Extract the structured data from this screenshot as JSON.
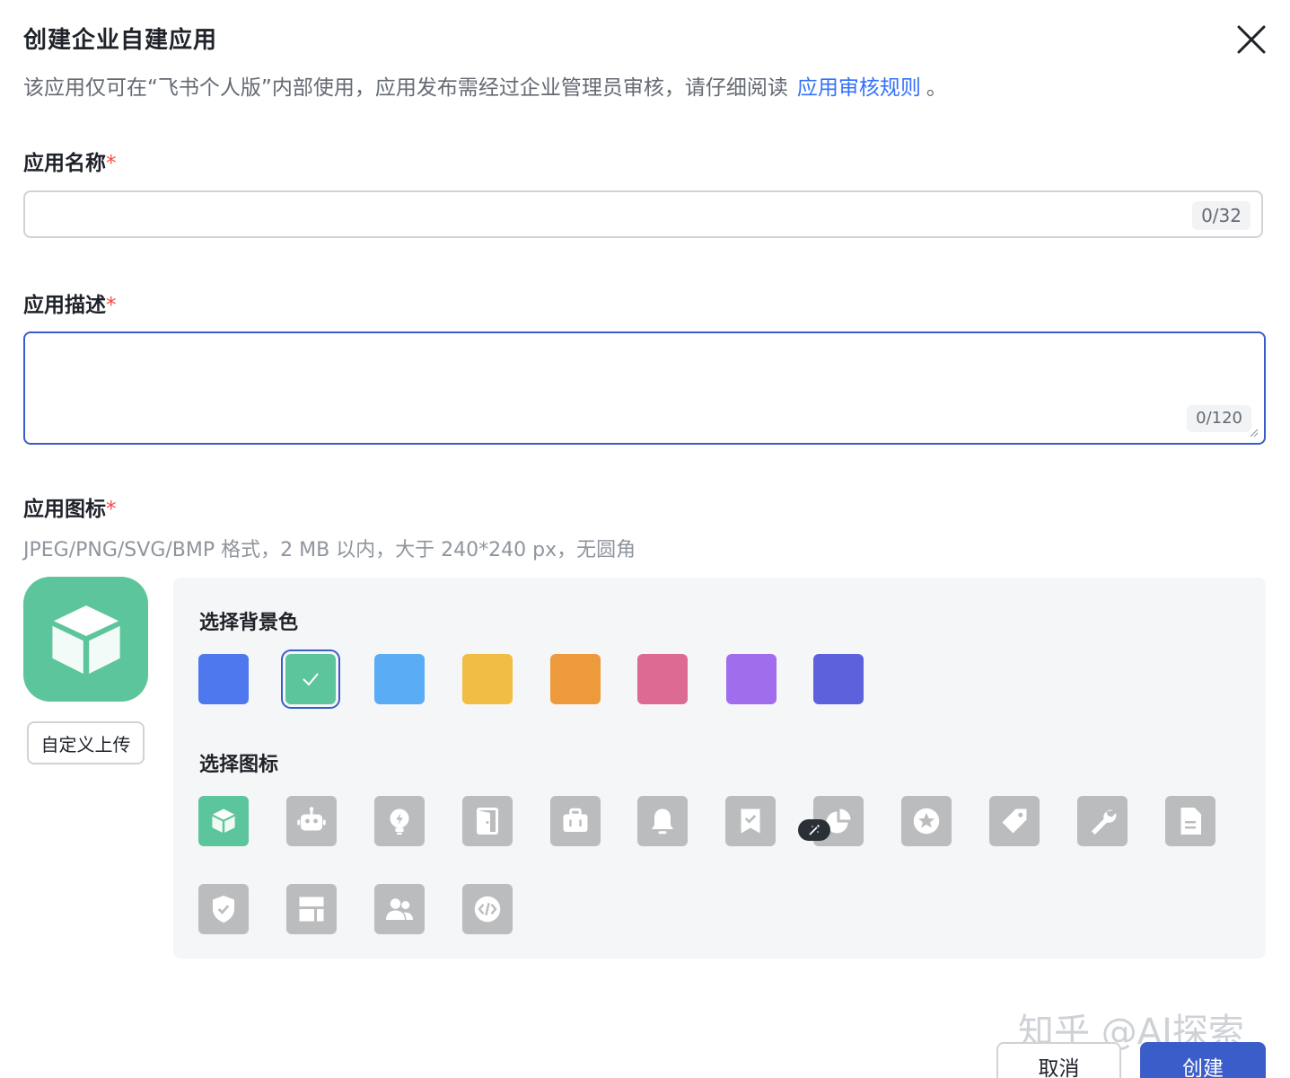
{
  "dialog": {
    "title": "创建企业自建应用",
    "subtitle": "该应用仅可在“飞书个人版”内部使用，应用发布需经过企业管理员审核，请仔细阅读",
    "rules_link": "应用审核规则",
    "subtitle_tail": "。"
  },
  "name_field": {
    "label": "应用名称",
    "required_mark": "*",
    "value": "",
    "counter": "0/32"
  },
  "desc_field": {
    "label": "应用描述",
    "required_mark": "*",
    "value": "",
    "counter": "0/120"
  },
  "icon_field": {
    "label": "应用图标",
    "required_mark": "*",
    "hint": "JPEG/PNG/SVG/BMP 格式，2 MB 以内，大于 240*240 px，无圆角",
    "upload_label": "自定义上传",
    "bg_title": "选择背景色",
    "icon_title": "选择图标",
    "bg_colors": [
      "#4e78ee",
      "#5cc59b",
      "#5aacf5",
      "#f2bd44",
      "#ed9a3c",
      "#dd6a92",
      "#a06ded",
      "#5e61dc"
    ],
    "selected_bg": "#5cc59b",
    "icons": [
      "cube-icon",
      "robot-icon",
      "lightbulb-icon",
      "door-icon",
      "briefcase-icon",
      "bell-icon",
      "bookmark-check-icon",
      "pie-chart-icon",
      "star-icon",
      "tag-icon",
      "wrench-icon",
      "document-icon",
      "shield-check-icon",
      "layout-icon",
      "users-icon",
      "code-icon"
    ],
    "selected_icon": "cube-icon"
  },
  "footer": {
    "cancel_label": "取消",
    "create_label": "创建",
    "primary_color": "#3a5dc9"
  },
  "watermark": "知乎 @AI探索"
}
